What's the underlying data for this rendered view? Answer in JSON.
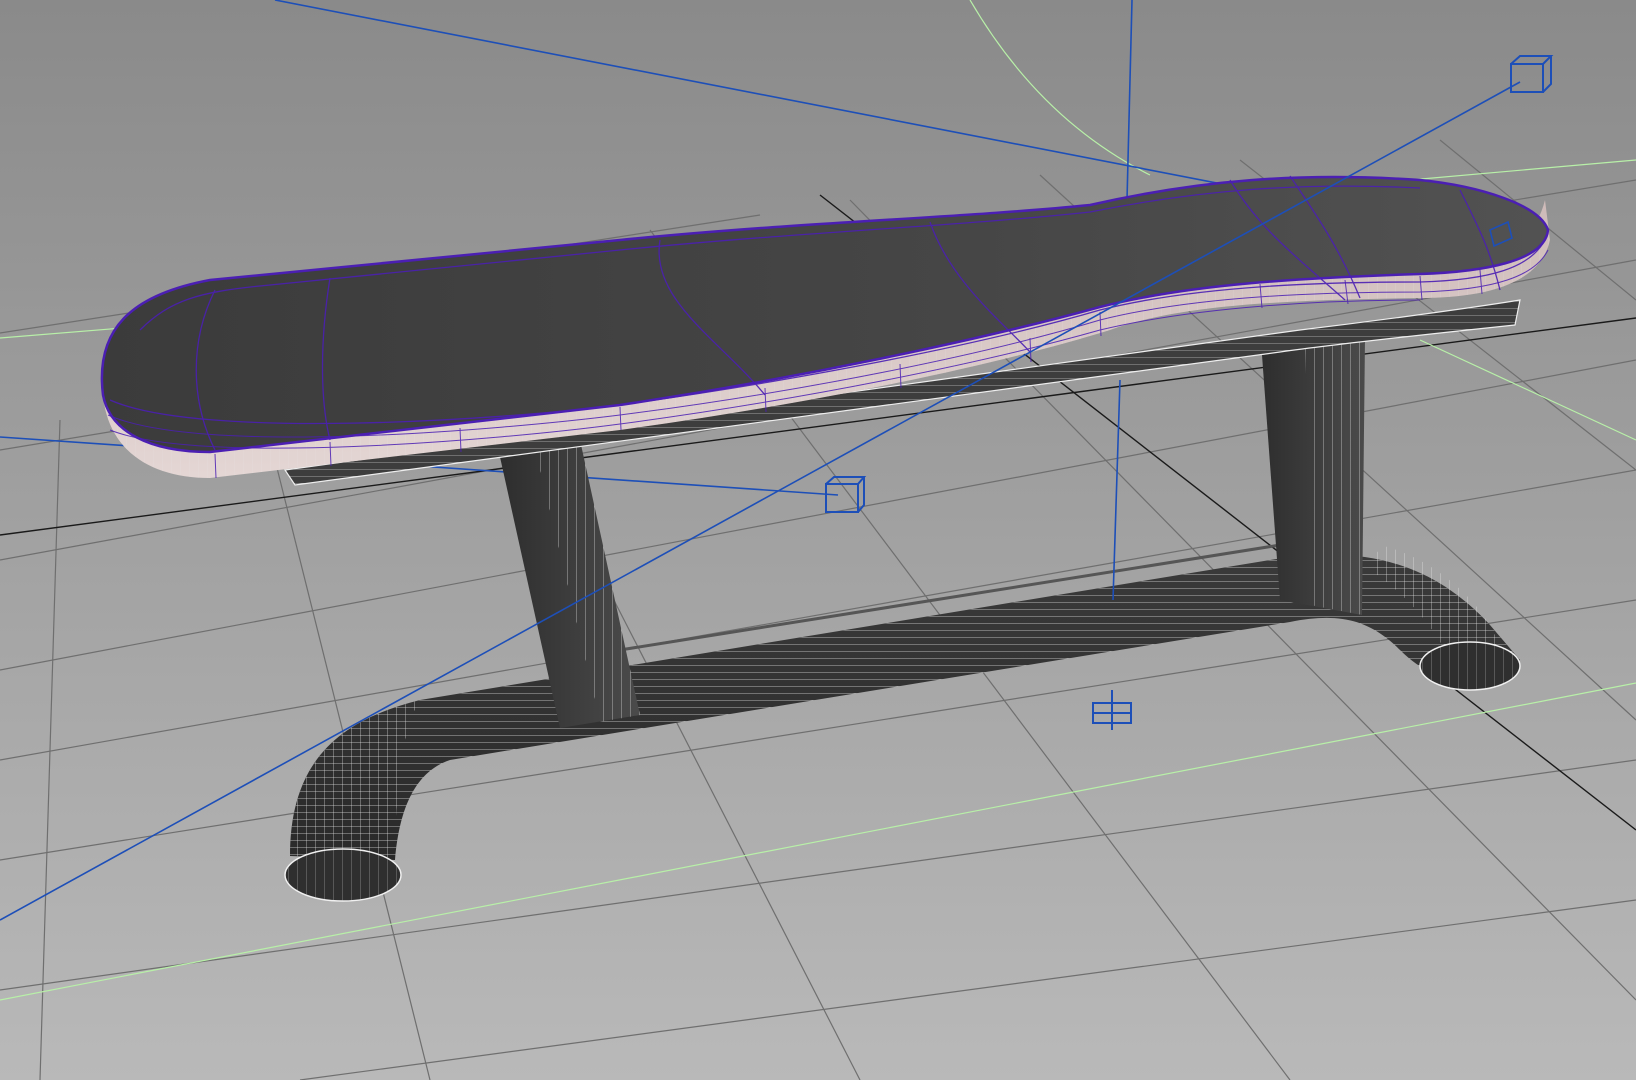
{
  "viewport": {
    "kind": "3d-perspective-viewport",
    "shading": "smooth-shaded-with-wireframe-on-shaded",
    "selected_object": "bench-seat-cushion",
    "colors": {
      "background_top": "#8a8a8a",
      "background_bottom": "#b9b9b9",
      "grid": "#6f6f6f",
      "grid_axis": "#1a1a1a",
      "grid_highlight": "#b8f0a8",
      "light_gizmo": "#1d4fb8",
      "selection_wire": "#4b1fb3",
      "mesh_wire": "#f2f2f2",
      "mesh_dark": "#3a3a3a",
      "cushion_side": "#d9c8c6"
    }
  },
  "scene": {
    "lights": [
      {
        "name": "area-light-right",
        "icon": "light-cube-icon"
      },
      {
        "name": "area-light-left",
        "icon": "light-cube-icon"
      },
      {
        "name": "point-light-bottom",
        "icon": "light-locator-icon"
      }
    ],
    "objects": [
      "bench-seat-cushion",
      "bench-seat-frame",
      "bench-post-left",
      "bench-post-right",
      "bench-base-rail"
    ]
  }
}
